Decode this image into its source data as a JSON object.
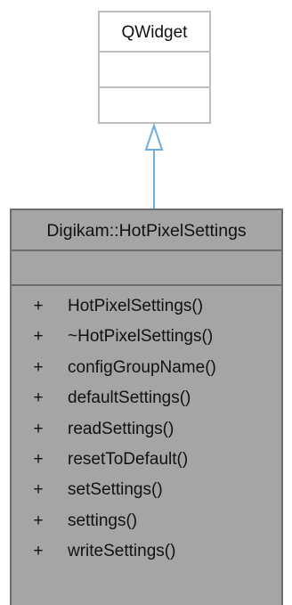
{
  "base_class": {
    "name": "QWidget"
  },
  "derived_class": {
    "name": "Digikam::HotPixelSettings",
    "operations": [
      {
        "visibility": "+",
        "name": "HotPixelSettings()"
      },
      {
        "visibility": "+",
        "name": "~HotPixelSettings()"
      },
      {
        "visibility": "+",
        "name": "configGroupName()"
      },
      {
        "visibility": "+",
        "name": "defaultSettings()"
      },
      {
        "visibility": "+",
        "name": "readSettings()"
      },
      {
        "visibility": "+",
        "name": "resetToDefault()"
      },
      {
        "visibility": "+",
        "name": "setSettings()"
      },
      {
        "visibility": "+",
        "name": "settings()"
      },
      {
        "visibility": "+",
        "name": "writeSettings()"
      }
    ]
  },
  "colors": {
    "arrow": "#6aaee8",
    "base_border": "#bdbdbd",
    "class_fill": "#a5a5a5",
    "class_border": "#6e6e6e"
  }
}
